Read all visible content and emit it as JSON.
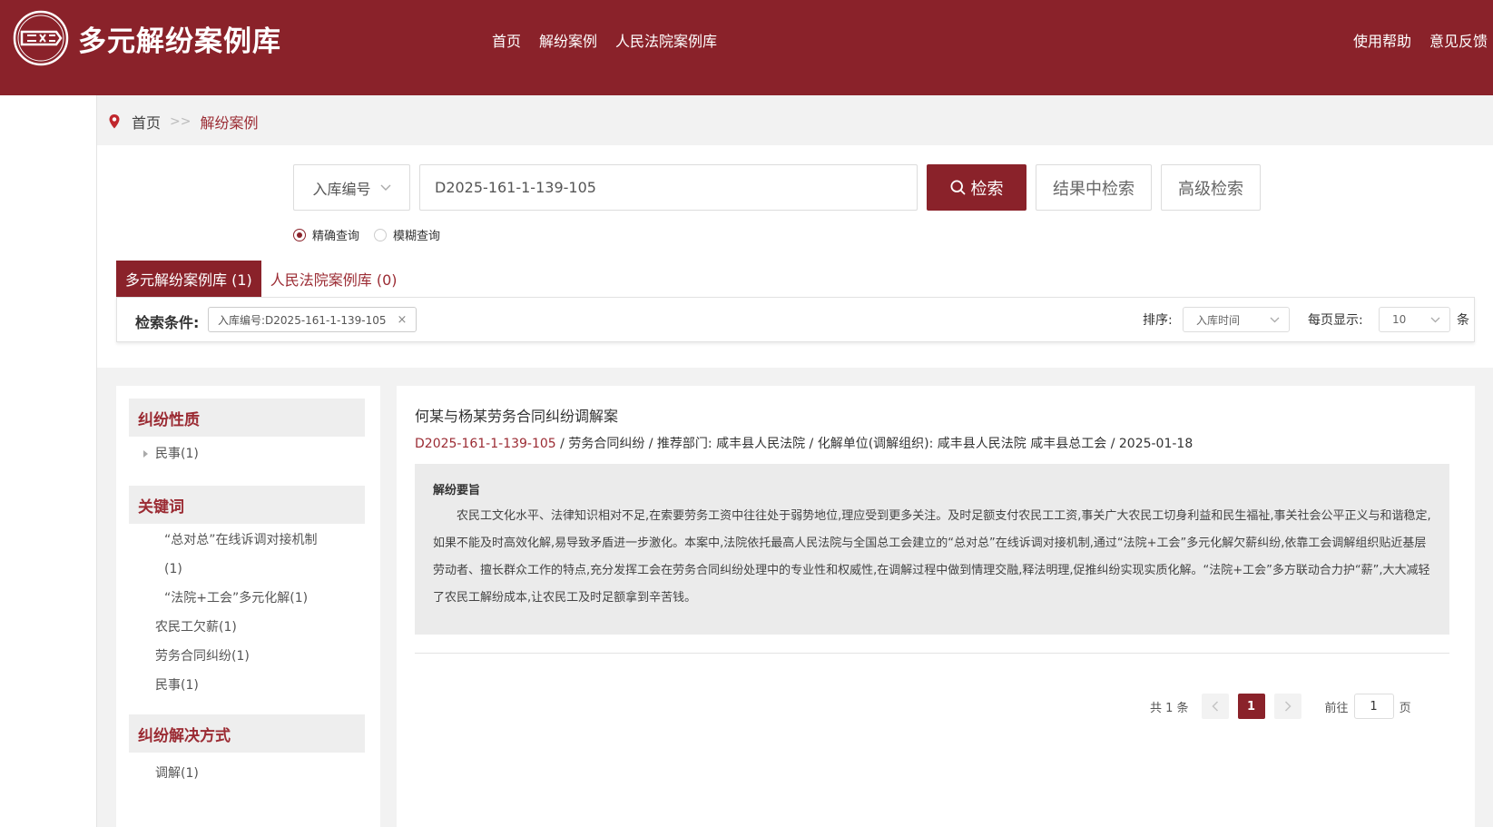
{
  "header": {
    "site_title": "多元解纷案例库",
    "nav": [
      "首页",
      "解纷案例",
      "人民法院案例库"
    ],
    "nav_right": [
      "使用帮助",
      "意见反馈"
    ]
  },
  "breadcrumb": {
    "home": "首页",
    "separator": ">>",
    "current": "解纷案例"
  },
  "search": {
    "field": "入库编号",
    "query": "D2025-161-1-139-105",
    "search_button": "检索",
    "in_results_button": "结果中检索",
    "advanced_button": "高级检索",
    "mode_exact": "精确查询",
    "mode_fuzzy": "模糊查询"
  },
  "tabs": [
    {
      "label": "多元解纷案例库 (1)"
    },
    {
      "label": "人民法院案例库 (0)"
    }
  ],
  "conditions": {
    "label": "检索条件:",
    "chip": "入库编号:D2025-161-1-139-105",
    "chip_close": "×",
    "sort_label": "排序:",
    "sort_value": "入库时间",
    "per_page_label": "每页显示:",
    "per_page_value": "10",
    "per_page_unit": "条"
  },
  "sidebar": {
    "facets": [
      {
        "title": "纠纷性质",
        "items": [
          "民事(1)"
        ]
      },
      {
        "title": "关键词",
        "items": [
          "“总对总”在线诉调对接机制",
          "(1)",
          "“法院+工会”多元化解(1)",
          "农民工欠薪(1)",
          "劳务合同纠纷(1)",
          "民事(1)"
        ]
      },
      {
        "title": "纠纷解决方式",
        "items": [
          "调解(1)"
        ]
      }
    ]
  },
  "result": {
    "title": "何某与杨某劳务合同纠纷调解案",
    "code": "D2025-161-1-139-105",
    "meta_rest": " / 劳务合同纠纷 / 推荐部门: 咸丰县人民法院  / 化解单位(调解组织): 咸丰县人民法院 咸丰县总工会  / 2025-01-18",
    "summary_title": "解纷要旨",
    "summary": "农民工文化水平、法律知识相对不足,在索要劳务工资中往往处于弱势地位,理应受到更多关注。及时足额支付农民工工资,事关广大农民工切身利益和民生福祉,事关社会公平正义与和谐稳定,如果不能及时高效化解,易导致矛盾进一步激化。本案中,法院依托最高人民法院与全国总工会建立的“总对总”在线诉调对接机制,通过“法院+工会”多元化解欠薪纠纷,依靠工会调解组织贴近基层劳动者、擅长群众工作的特点,充分发挥工会在劳务合同纠纷处理中的专业性和权威性,在调解过程中做到情理交融,释法明理,促推纠纷实现实质化解。“法院+工会”多方联动合力护“薪”,大大减轻了农民工解纷成本,让农民工及时足额拿到辛苦钱。"
  },
  "pagination": {
    "total": "共 1 条",
    "current": "1",
    "goto_label": "前往",
    "goto_value": "1",
    "page_unit": "页"
  },
  "colors": {
    "brand": "#8a222a",
    "accent_text": "#9b2b33"
  }
}
